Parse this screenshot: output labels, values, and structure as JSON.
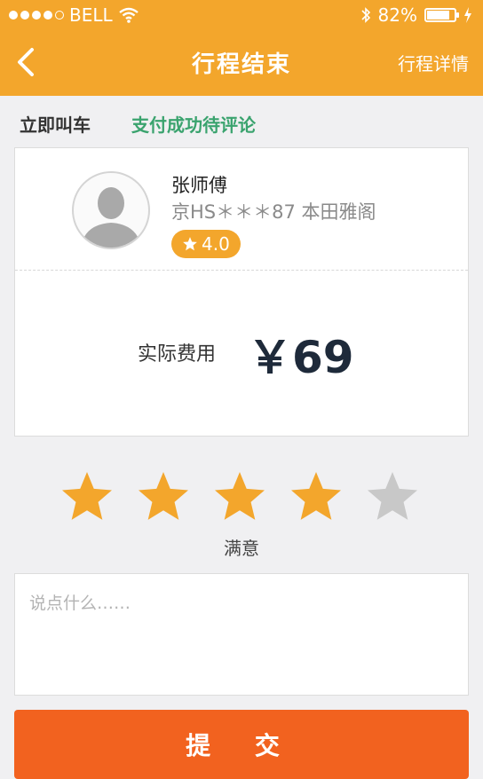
{
  "status_bar": {
    "carrier": "BELL",
    "battery_percent": "82%",
    "battery_level": 0.82,
    "signal_filled": 4,
    "signal_total": 5
  },
  "nav": {
    "back_icon": "chevron-left-icon",
    "title": "行程结束",
    "right_link": "行程详情"
  },
  "progress": {
    "step1": "立即叫车",
    "step2": "支付成功待评论"
  },
  "driver": {
    "name": "张师傅",
    "plate_and_car": "京HS＊＊＊87  本田雅阁",
    "rating": "4.0"
  },
  "fare": {
    "label": "实际费用",
    "amount": "￥69"
  },
  "review": {
    "stars_total": 5,
    "stars_selected": 4,
    "rating_text": "满意",
    "comment_placeholder": "说点什么……",
    "comment_value": ""
  },
  "submit": {
    "label": "提 交"
  },
  "colors": {
    "header": "#f3a62c",
    "accent_green": "#3aa36e",
    "star_on": "#f3a62c",
    "star_off": "#c8c8c8",
    "submit": "#f2621f"
  }
}
